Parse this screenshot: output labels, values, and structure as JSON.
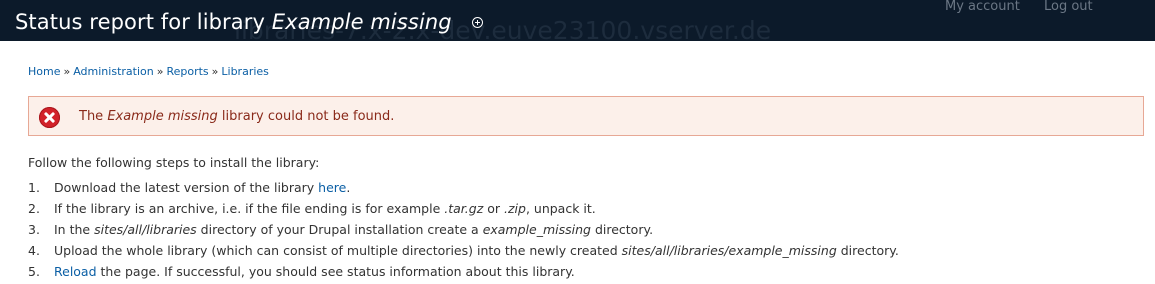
{
  "header": {
    "title_prefix": "Status report for library ",
    "title_library": "Example missing",
    "site_name": "libraries-7.x-2.x-dev.euve23100.vserver.de",
    "user_links": [
      "My account",
      "Log out"
    ]
  },
  "breadcrumb": [
    {
      "label": "Home"
    },
    {
      "label": "Administration"
    },
    {
      "label": "Reports"
    },
    {
      "label": "Libraries"
    }
  ],
  "breadcrumb_separator": "»",
  "error": {
    "prefix": "The ",
    "library": "Example missing",
    "suffix": " library could not be found."
  },
  "instructions": {
    "intro": "Follow the following steps to install the library:",
    "numbers": [
      "1.",
      "2.",
      "3.",
      "4.",
      "5."
    ],
    "step1": {
      "text": "Download the latest version of the library ",
      "link": "here",
      "end": "."
    },
    "step2": {
      "text": "If the library is an archive, i.e. if the file ending is for example ",
      "ext1": ".tar.gz",
      "mid": " or ",
      "ext2": ".zip",
      "end": ", unpack it."
    },
    "step3": {
      "text": "In the ",
      "path": "sites/all/libraries",
      "mid": " directory of your Drupal installation create a ",
      "dir": "example_missing",
      "end": " directory."
    },
    "step4": {
      "text": "Upload the whole library (which can consist of multiple directories) into the newly created ",
      "path": "sites/all/libraries/example_missing",
      "end": " directory."
    },
    "step5": {
      "link": "Reload",
      "text": " the page. If successful, you should see status information about this library."
    }
  }
}
